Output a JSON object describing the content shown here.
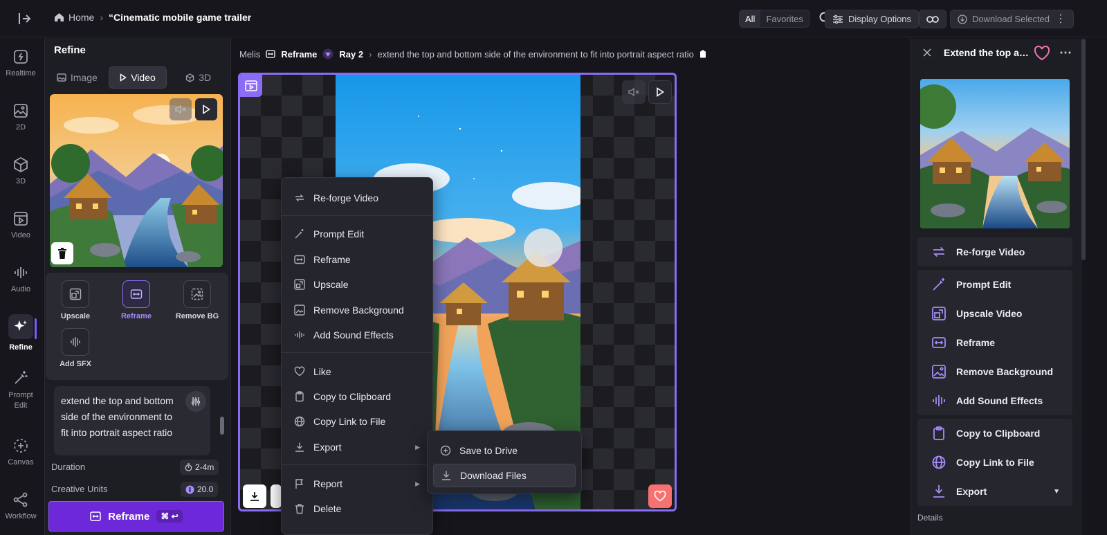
{
  "topbar": {
    "home": "Home",
    "title": "“Cinematic mobile game trailer",
    "seg_all": "All",
    "seg_fav": "Favorites",
    "display_options": "Display Options",
    "download_selected": "Download Selected"
  },
  "rail": {
    "realtime": "Realtime",
    "d2": "2D",
    "d3": "3D",
    "video": "Video",
    "audio": "Audio",
    "refine": "Refine",
    "prompt_edit_1": "Prompt",
    "prompt_edit_2": "Edit",
    "canvas": "Canvas",
    "workflow": "Workflow"
  },
  "refine": {
    "title": "Refine",
    "tabs": [
      "Image",
      "Video",
      "3D"
    ],
    "tools": [
      "Upscale",
      "Reframe",
      "Remove BG",
      "Add SFX"
    ],
    "prompt": "extend the top and bottom side of the environment to fit into portrait aspect ratio",
    "duration_label": "Duration",
    "duration_value": "2-4m",
    "units_label": "Creative Units",
    "units_value": "20.0",
    "cta": "Reframe",
    "cta_shortcut": "⌘ ↩"
  },
  "center": {
    "user": "Melis",
    "action": "Reframe",
    "model": "Ray 2",
    "prompt": "extend the top and bottom side of the environment to fit into portrait aspect ratio"
  },
  "menu": {
    "items": [
      "Re-forge Video",
      "Prompt Edit",
      "Reframe",
      "Upscale",
      "Remove Background",
      "Add Sound Effects",
      "Like",
      "Copy to Clipboard",
      "Copy Link to File",
      "Export",
      "Report",
      "Delete"
    ],
    "submenu": [
      "Save to Drive",
      "Download Files"
    ]
  },
  "right": {
    "title": "Extend the top and bottom side of the environment",
    "actions": [
      "Re-forge Video",
      "Prompt Edit",
      "Upscale Video",
      "Reframe",
      "Remove Background",
      "Add Sound Effects",
      "Copy to Clipboard",
      "Copy Link to File",
      "Export"
    ],
    "details": "Details"
  },
  "colors": {
    "accent": "#8b6cf6",
    "cta": "#6d28d9",
    "like": "#f87171"
  }
}
